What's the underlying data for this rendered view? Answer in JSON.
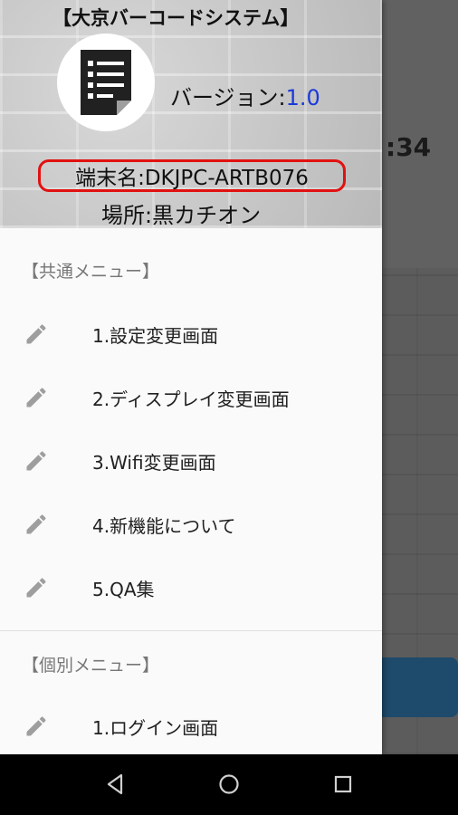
{
  "background": {
    "time_fragment": ":34"
  },
  "header": {
    "app_title": "【大京バーコードシステム】",
    "version_label": "バージョン:",
    "version_number": "1.0",
    "terminal": "端末名:DKJPC-ARTB076",
    "location": "場所:黒カチオン"
  },
  "common_menu": {
    "title": "【共通メニュー】",
    "items": [
      {
        "label": "1.設定変更画面",
        "icon": "pencil-icon"
      },
      {
        "label": "2.ディスプレイ変更画面",
        "icon": "pencil-icon"
      },
      {
        "label": "3.Wifi変更画面",
        "icon": "pencil-icon"
      },
      {
        "label": "4.新機能について",
        "icon": "pencil-icon"
      },
      {
        "label": "5.QA集",
        "icon": "pencil-icon"
      }
    ]
  },
  "individual_menu": {
    "title": "【個別メニュー】",
    "items": [
      {
        "label": "1.ログイン画面",
        "icon": "pencil-icon"
      }
    ]
  },
  "colors": {
    "version_number": "#1a3adb",
    "terminal_border": "#e21111"
  },
  "navbar": {
    "buttons": [
      "back-icon",
      "home-icon",
      "recents-icon"
    ]
  }
}
